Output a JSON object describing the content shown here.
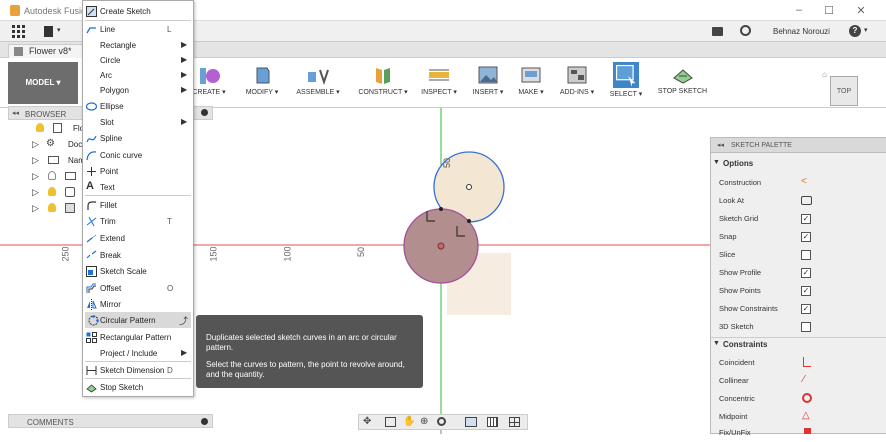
{
  "app": {
    "title": "Autodesk Fusion"
  },
  "user": {
    "name": "Behnaz Norouzi"
  },
  "document": {
    "tab": "Flower v8*"
  },
  "ribbon": {
    "workspace": "MODEL ▾",
    "groups": [
      "CREATE ▾",
      "MODIFY ▾",
      "ASSEMBLE ▾",
      "CONSTRUCT ▾",
      "INSPECT ▾",
      "INSERT ▾",
      "MAKE ▾",
      "ADD-INS ▾",
      "SELECT ▾",
      "STOP SKETCH"
    ]
  },
  "browser": {
    "title": "BROWSER",
    "items": [
      "Flo",
      "Doc",
      "Nam",
      "",
      "",
      ""
    ],
    "comments": "COMMENTS"
  },
  "canvas": {
    "rulers": [
      "250",
      "150",
      "100",
      "50"
    ],
    "dim_label": "50"
  },
  "create_menu": {
    "items": [
      {
        "label": "Create Sketch",
        "shortcut": "",
        "arrow": ""
      },
      {
        "label": "Line",
        "shortcut": "L",
        "arrow": ""
      },
      {
        "label": "Rectangle",
        "shortcut": "",
        "arrow": "▶"
      },
      {
        "label": "Circle",
        "shortcut": "",
        "arrow": "▶"
      },
      {
        "label": "Arc",
        "shortcut": "",
        "arrow": "▶"
      },
      {
        "label": "Polygon",
        "shortcut": "",
        "arrow": "▶"
      },
      {
        "label": "Ellipse",
        "shortcut": "",
        "arrow": ""
      },
      {
        "label": "Slot",
        "shortcut": "",
        "arrow": "▶"
      },
      {
        "label": "Spline",
        "shortcut": "",
        "arrow": ""
      },
      {
        "label": "Conic curve",
        "shortcut": "",
        "arrow": ""
      },
      {
        "label": "Point",
        "shortcut": "",
        "arrow": ""
      },
      {
        "label": "Text",
        "shortcut": "",
        "arrow": ""
      },
      {
        "label": "Fillet",
        "shortcut": "",
        "arrow": ""
      },
      {
        "label": "Trim",
        "shortcut": "T",
        "arrow": ""
      },
      {
        "label": "Extend",
        "shortcut": "",
        "arrow": ""
      },
      {
        "label": "Break",
        "shortcut": "",
        "arrow": ""
      },
      {
        "label": "Sketch Scale",
        "shortcut": "",
        "arrow": ""
      },
      {
        "label": "Offset",
        "shortcut": "O",
        "arrow": ""
      },
      {
        "label": "Mirror",
        "shortcut": "",
        "arrow": ""
      },
      {
        "label": "Circular Pattern",
        "shortcut": "",
        "arrow": ""
      },
      {
        "label": "Rectangular Pattern",
        "shortcut": "",
        "arrow": ""
      },
      {
        "label": "Project / Include",
        "shortcut": "",
        "arrow": "▶"
      },
      {
        "label": "Sketch Dimension",
        "shortcut": "D",
        "arrow": ""
      },
      {
        "label": "Stop Sketch",
        "shortcut": "",
        "arrow": ""
      }
    ]
  },
  "tooltip": {
    "line1": "Duplicates selected sketch curves in an arc or circular pattern.",
    "line2": "Select the curves to pattern, the point to revolve around, and the quantity."
  },
  "palette": {
    "title": "SKETCH PALETTE",
    "options_header": "Options",
    "options": [
      {
        "label": "Construction",
        "type": "icon"
      },
      {
        "label": "Look At",
        "type": "icon"
      },
      {
        "label": "Sketch Grid",
        "type": "check",
        "checked": true
      },
      {
        "label": "Snap",
        "type": "check",
        "checked": true
      },
      {
        "label": "Slice",
        "type": "check",
        "checked": false
      },
      {
        "label": "Show Profile",
        "type": "check",
        "checked": true
      },
      {
        "label": "Show Points",
        "type": "check",
        "checked": true
      },
      {
        "label": "Show Constraints",
        "type": "check",
        "checked": true
      },
      {
        "label": "3D Sketch",
        "type": "check",
        "checked": false
      }
    ],
    "constraints_header": "Constraints",
    "constraints": [
      "Coincident",
      "Collinear",
      "Concentric",
      "Midpoint",
      "Fix/UnFix"
    ]
  },
  "viewcube": {
    "label": "TOP"
  },
  "colors": {
    "accent": "#1e6fd9",
    "axis_red": "#e05050",
    "axis_green": "#3cb43c",
    "profile": "#f3e6d3",
    "selected": "#b38e8e"
  }
}
